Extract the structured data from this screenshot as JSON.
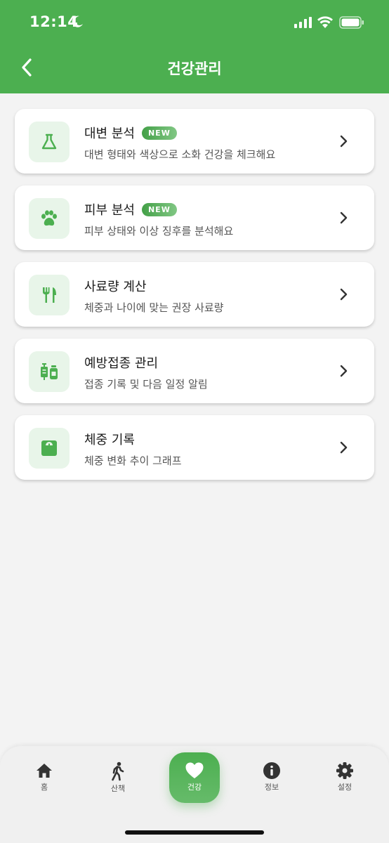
{
  "status_bar": {
    "time": "12:14"
  },
  "header": {
    "title": "건강관리",
    "back_icon": "chevron-left-icon"
  },
  "colors": {
    "primary": "#4caf50",
    "icon_bg": "#e8f5e9"
  },
  "menu": [
    {
      "title": "대변 분석",
      "badge": "NEW",
      "description": "대변 형태와 색상으로 소화 건강을 체크해요",
      "icon": "flask-icon"
    },
    {
      "title": "피부 분석",
      "badge": "NEW",
      "description": "피부 상태와 이상 징후를 분석해요",
      "icon": "paw-icon"
    },
    {
      "title": "사료량 계산",
      "badge": "",
      "description": "체중과 나이에 맞는 권장 사료량",
      "icon": "fork-knife-icon"
    },
    {
      "title": "예방접종 관리",
      "badge": "",
      "description": "접종 기록 및 다음 일정 알림",
      "icon": "vaccine-icon"
    },
    {
      "title": "체중 기록",
      "badge": "",
      "description": "체중 변화 추이 그래프",
      "icon": "scale-icon"
    }
  ],
  "tab_bar": {
    "items": [
      {
        "label": "홈",
        "icon": "home-icon"
      },
      {
        "label": "산책",
        "icon": "walk-icon"
      },
      {
        "label": "건강",
        "icon": "heart-icon",
        "active": true
      },
      {
        "label": "정보",
        "icon": "info-icon"
      },
      {
        "label": "설정",
        "icon": "gear-icon"
      }
    ]
  }
}
